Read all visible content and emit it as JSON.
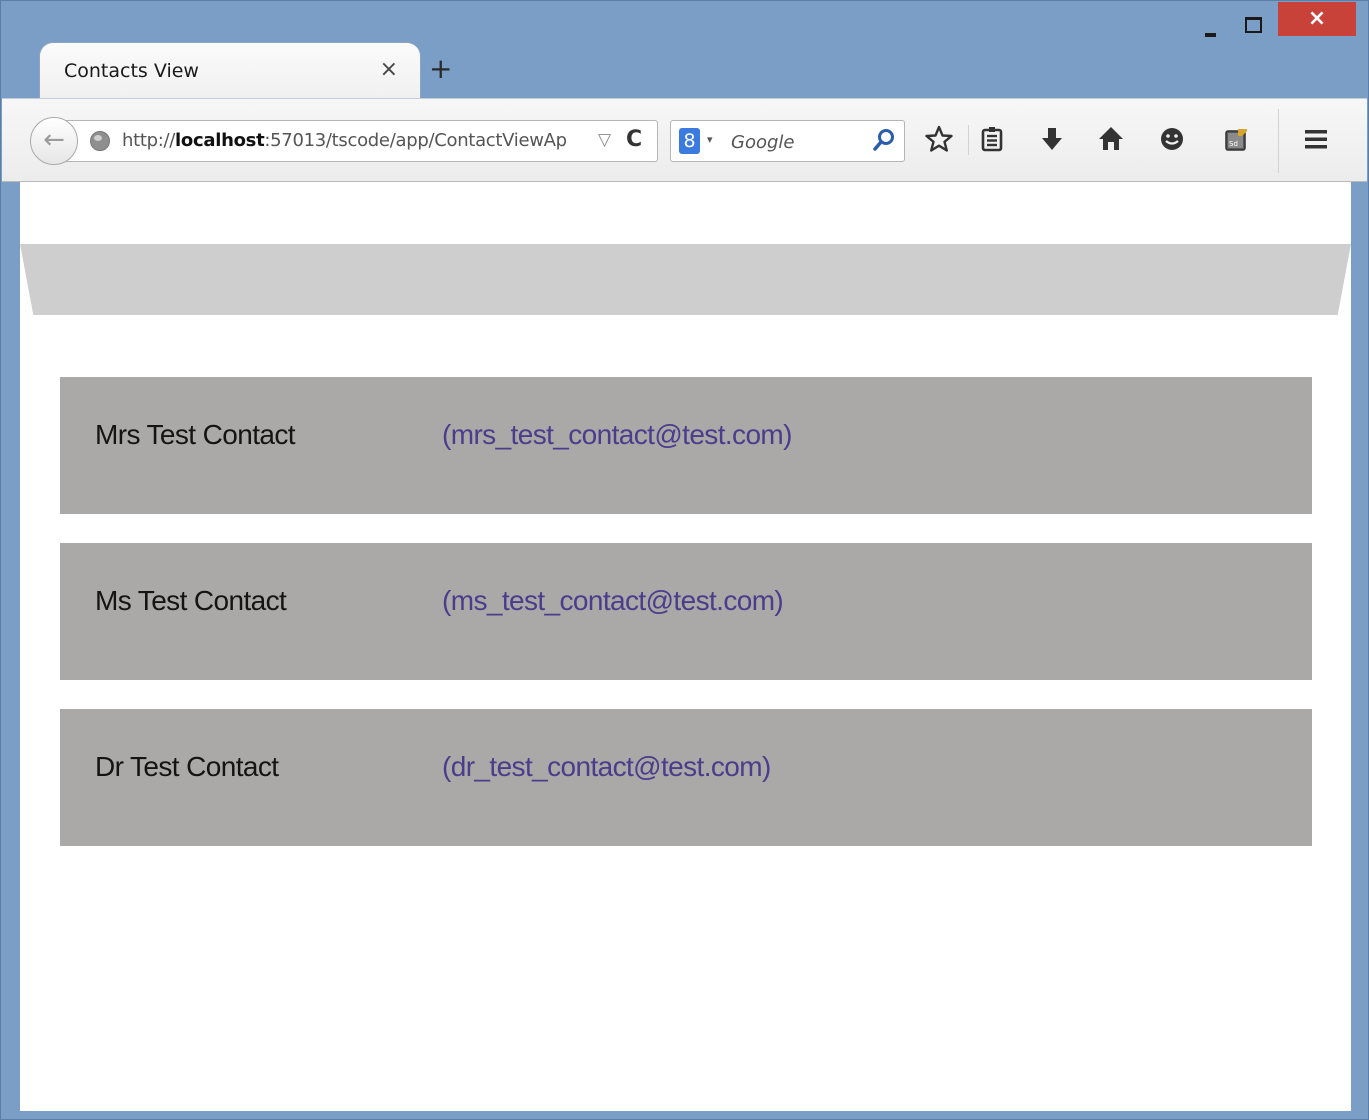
{
  "browser": {
    "tab": {
      "title": "Contacts View",
      "close_glyph": "×"
    },
    "new_tab_glyph": "+",
    "window_controls": {
      "close_glyph": "×"
    },
    "nav": {
      "back_glyph": "←",
      "url_prefix": "http://",
      "url_host": "localhost",
      "url_rest": ":57013/tscode/app/ContactViewAp",
      "url_dropdown_glyph": "▽",
      "reload_glyph": "C",
      "search_engine_glyph": "8",
      "search_dropdown_glyph": "▾",
      "search_placeholder": "Google"
    },
    "toolbar_icons": [
      "bookmark-star-icon",
      "reading-list-icon",
      "downloads-icon",
      "home-icon",
      "smiley-icon",
      "screenshot-addon-icon",
      "menu-icon"
    ]
  },
  "page": {
    "banner_color": "#cecece",
    "card_color": "#aaa9a7",
    "email_color": "#4b3d8c",
    "contacts": [
      {
        "name": "Mrs Test Contact",
        "email": "(mrs_test_contact@test.com)"
      },
      {
        "name": "Ms Test Contact",
        "email": "(ms_test_contact@test.com)"
      },
      {
        "name": "Dr Test Contact",
        "email": "(dr_test_contact@test.com)"
      }
    ]
  }
}
